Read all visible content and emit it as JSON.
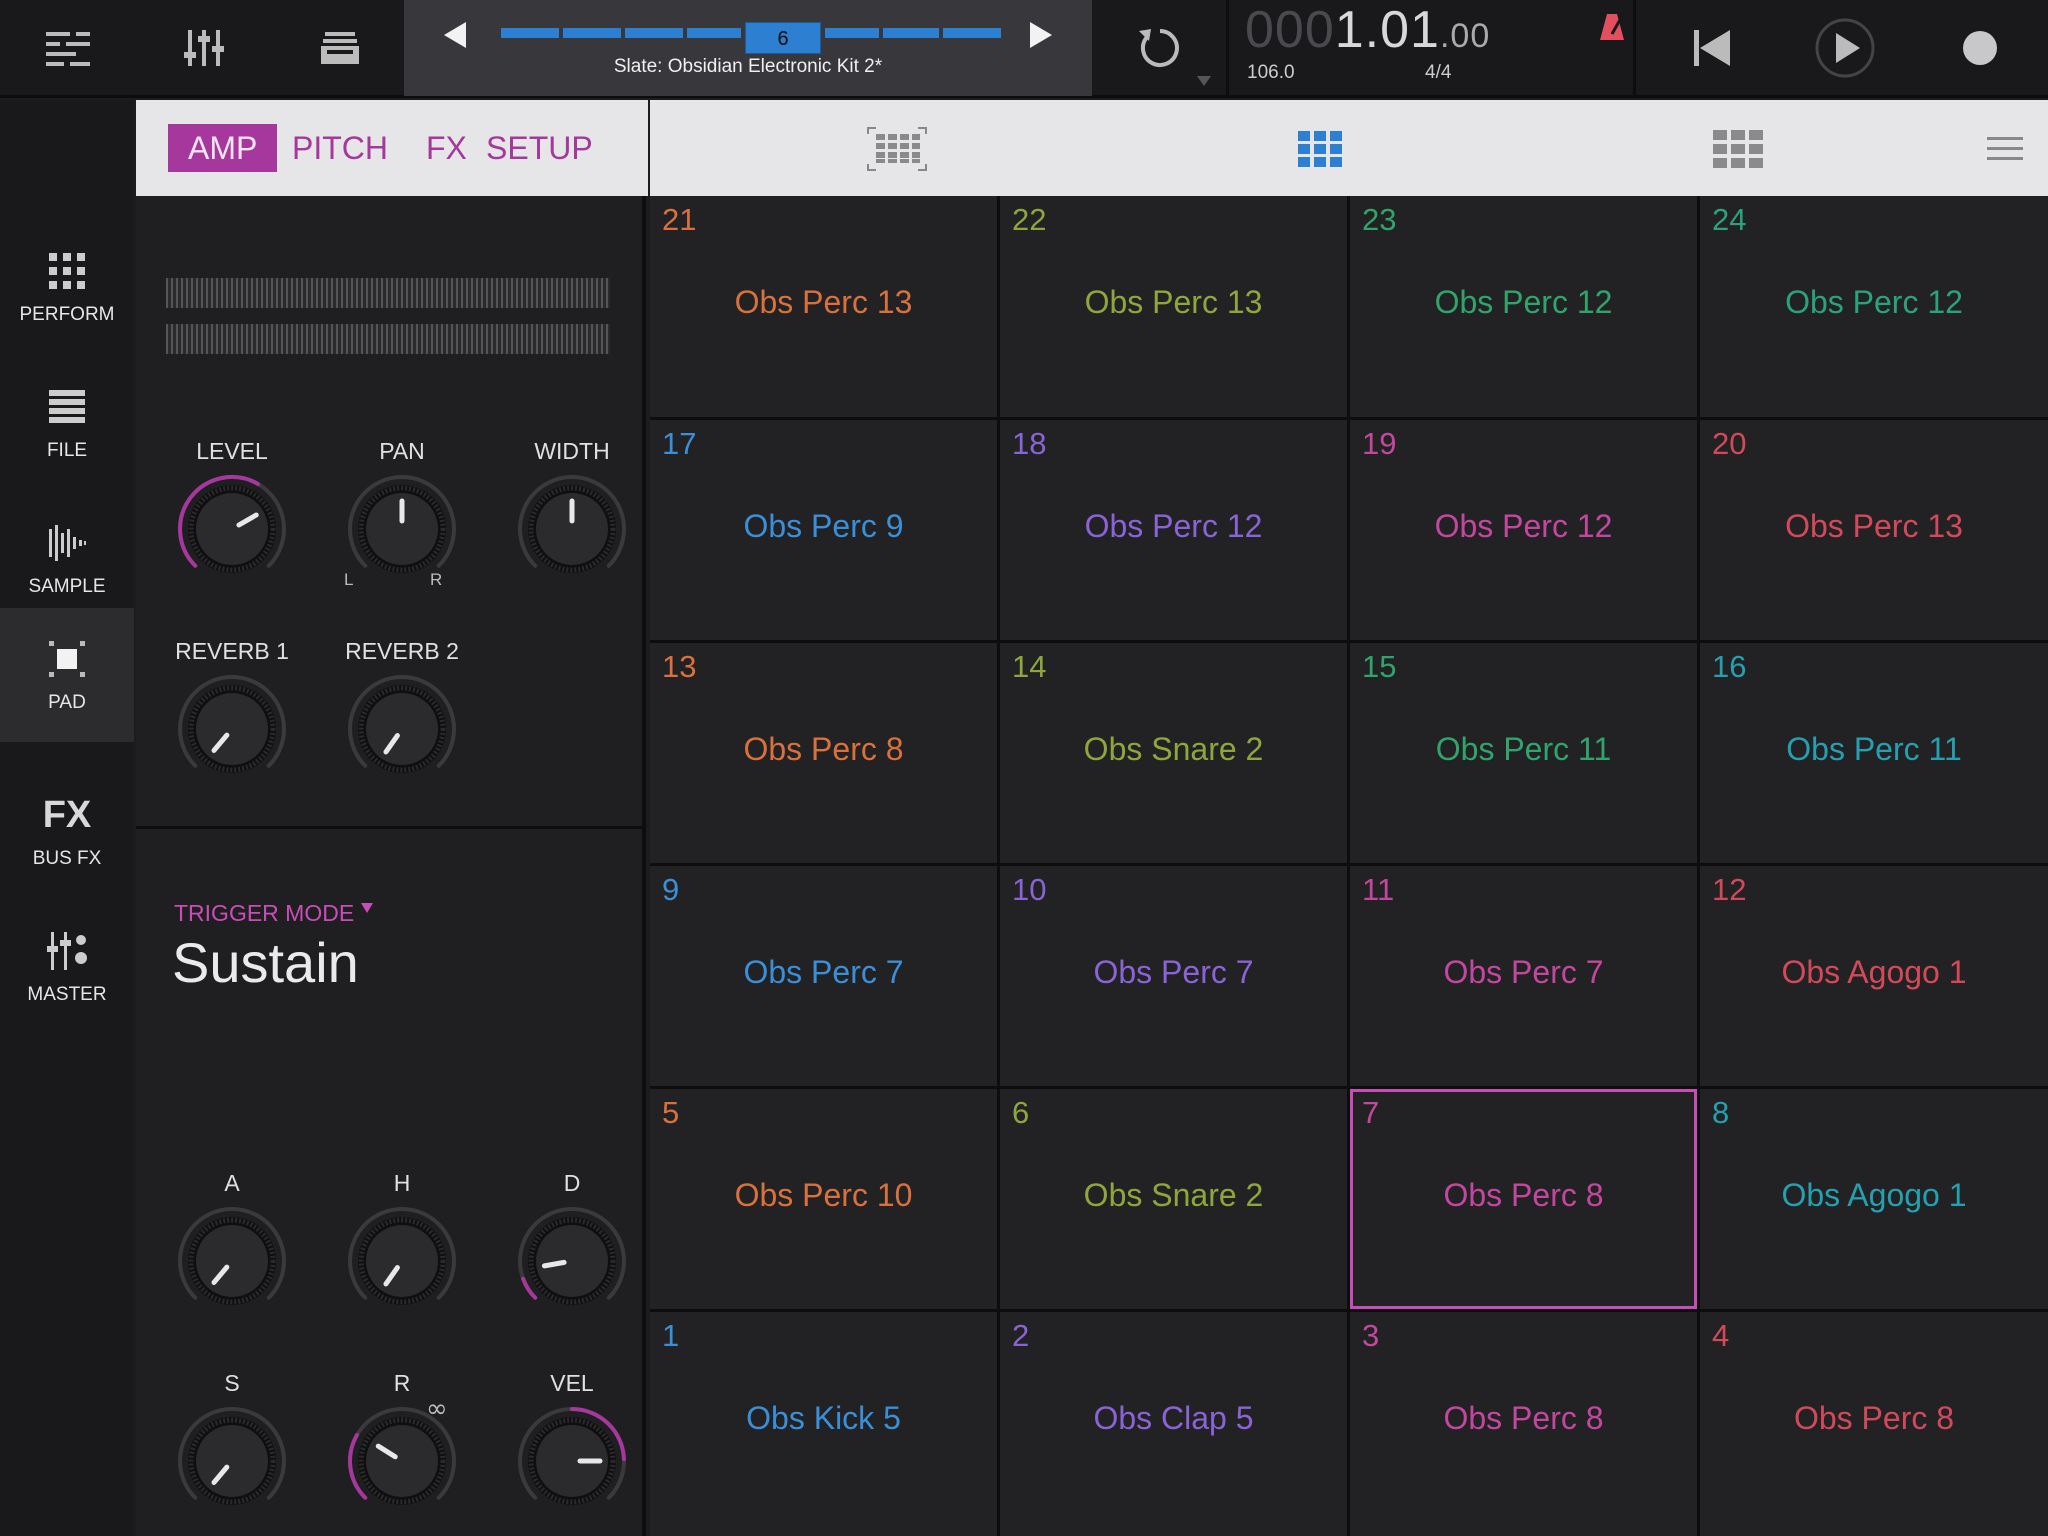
{
  "topbar": {
    "kit_name": "Slate: Obsidian Electronic Kit 2*",
    "kit_index": "6",
    "counter_dim": "000",
    "counter_bright": "1.01",
    "counter_small": ".00",
    "tempo": "106.0",
    "time_signature": "4/4"
  },
  "nav": {
    "perform": "PERFORM",
    "file": "FILE",
    "sample": "SAMPLE",
    "pad": "PAD",
    "busfx_glyph": "FX",
    "busfx": "BUS FX",
    "master": "MASTER"
  },
  "edit": {
    "tabs": [
      "AMP",
      "PITCH",
      "FX",
      "SETUP"
    ],
    "active_tab": "AMP",
    "knobs": {
      "level": "LEVEL",
      "pan": "PAN",
      "pan_l": "L",
      "pan_r": "R",
      "width": "WIDTH",
      "reverb1": "REVERB 1",
      "reverb2": "REVERB 2",
      "a": "A",
      "h": "H",
      "d": "D",
      "s": "S",
      "r": "R",
      "vel": "VEL"
    },
    "trigger_mode_label": "TRIGGER MODE",
    "trigger_mode_value": "Sustain",
    "release_infinity": "∞"
  },
  "colors": {
    "accent_magenta": "#a6379c",
    "accent_blue": "#2d7fd1",
    "record_tempo": "#e0505f"
  },
  "pads": [
    {
      "num": "21",
      "name": "Obs Perc 13",
      "color": "#d8713d"
    },
    {
      "num": "22",
      "name": "Obs Perc 13",
      "color": "#8fa63c"
    },
    {
      "num": "23",
      "name": "Obs Perc 12",
      "color": "#2fa56b"
    },
    {
      "num": "24",
      "name": "Obs Perc 12",
      "color": "#2aa37a"
    },
    {
      "num": "17",
      "name": "Obs Perc 9",
      "color": "#3a8fd8"
    },
    {
      "num": "18",
      "name": "Obs Perc 12",
      "color": "#8a63d6"
    },
    {
      "num": "19",
      "name": "Obs Perc 12",
      "color": "#c4479f"
    },
    {
      "num": "20",
      "name": "Obs Perc 13",
      "color": "#d24a5a"
    },
    {
      "num": "13",
      "name": "Obs Perc 8",
      "color": "#d8713d"
    },
    {
      "num": "14",
      "name": "Obs Snare 2",
      "color": "#8fa63c"
    },
    {
      "num": "15",
      "name": "Obs Perc 11",
      "color": "#2fa56b"
    },
    {
      "num": "16",
      "name": "Obs Perc 11",
      "color": "#24a0b0"
    },
    {
      "num": "9",
      "name": "Obs Perc 7",
      "color": "#3a8fd8"
    },
    {
      "num": "10",
      "name": "Obs Perc 7",
      "color": "#8a63d6"
    },
    {
      "num": "11",
      "name": "Obs Perc 7",
      "color": "#c4479f"
    },
    {
      "num": "12",
      "name": "Obs Agogo 1",
      "color": "#d24a5a"
    },
    {
      "num": "5",
      "name": "Obs Perc 10",
      "color": "#d8713d"
    },
    {
      "num": "6",
      "name": "Obs Snare 2",
      "color": "#8fa63c"
    },
    {
      "num": "7",
      "name": "Obs Perc 8",
      "color": "#c4479f",
      "selected": true
    },
    {
      "num": "8",
      "name": "Obs Agogo 1",
      "color": "#24a0b0"
    },
    {
      "num": "1",
      "name": "Obs Kick 5",
      "color": "#3a8fd8"
    },
    {
      "num": "2",
      "name": "Obs Clap 5",
      "color": "#8a63d6"
    },
    {
      "num": "3",
      "name": "Obs Perc 8",
      "color": "#c4479f"
    },
    {
      "num": "4",
      "name": "Obs Perc 8",
      "color": "#d24a5a"
    }
  ]
}
